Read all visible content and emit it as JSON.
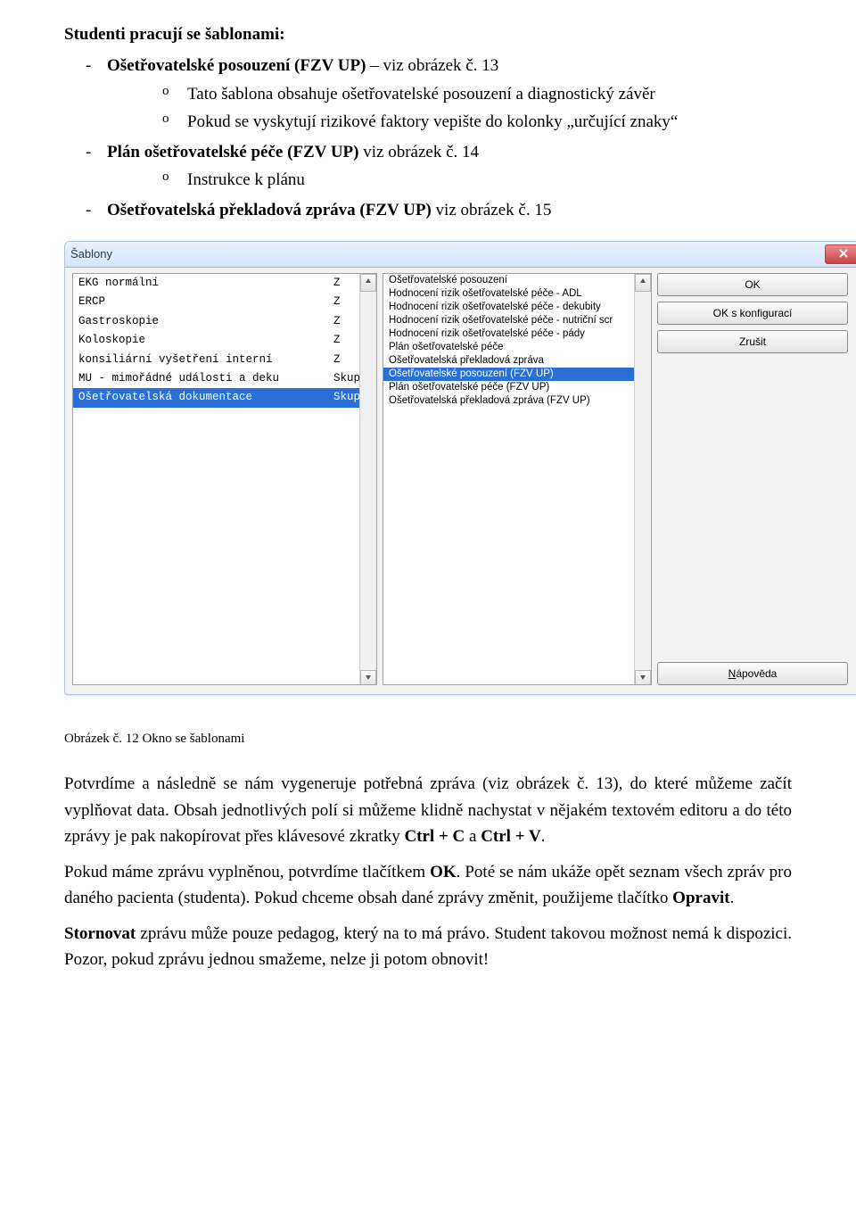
{
  "doc": {
    "heading": "Studenti pracují se šablonami:",
    "dash1_prefix": "Ošetřovatelské posouzení (FZV UP)",
    "dash1_rest": " – viz obrázek č. 13",
    "circ1a": "Tato šablona obsahuje ošetřovatelské posouzení a diagnostický závěr",
    "circ1b": "Pokud se vyskytují rizikové faktory vepište do kolonky „určující znaky“",
    "dash2_prefix": "Plán ošetřovatelské péče (FZV UP)",
    "dash2_rest": " viz obrázek č. 14",
    "circ2a": "Instrukce k plánu",
    "dash3_prefix": "Ošetřovatelská překladová zpráva (FZV UP)",
    "dash3_rest": " viz obrázek č. 15"
  },
  "dialog": {
    "title": "Šablony",
    "buttons": {
      "ok": "OK",
      "ok_cfg": "OK s konfigurací",
      "cancel": "Zrušit",
      "help": "Nápověda"
    },
    "left": [
      {
        "name": "EKG normální",
        "type": "Z",
        "sel": false
      },
      {
        "name": "ERCP",
        "type": "Z",
        "sel": false
      },
      {
        "name": "Gastroskopie",
        "type": "Z",
        "sel": false
      },
      {
        "name": "Koloskopie",
        "type": "Z",
        "sel": false
      },
      {
        "name": "konsiliární vyšetření interní",
        "type": "Z",
        "sel": false
      },
      {
        "name": "MU - mimořádné události a deku",
        "type": "Skup",
        "sel": false
      },
      {
        "name": "Ošetřovatelská dokumentace",
        "type": "Skup",
        "sel": true
      }
    ],
    "mid": [
      {
        "label": "Ošetřovatelské posouzení",
        "sel": false
      },
      {
        "label": "Hodnocení rizik ošetřovatelské péče - ADL",
        "sel": false
      },
      {
        "label": "Hodnocení rizik ošetřovatelské péče - dekubity",
        "sel": false
      },
      {
        "label": "Hodnocení rizik ošetřovatelské péče - nutriční scr",
        "sel": false
      },
      {
        "label": "Hodnocení rizik ošetřovatelské péče - pády",
        "sel": false
      },
      {
        "label": "Plán ošetřovatelské péče",
        "sel": false
      },
      {
        "label": "Ošetřovatelská překladová zpráva",
        "sel": false
      },
      {
        "label": "Ošetřovatelské posouzení (FZV UP)",
        "sel": true
      },
      {
        "label": "Plán ošetřovatelské péče (FZV UP)",
        "sel": false
      },
      {
        "label": "Ošetřovatelská překladová zpráva (FZV UP)",
        "sel": false
      }
    ]
  },
  "caption": "Obrázek č. 12 Okno se šablonami",
  "para1_a": "Potvrdíme a následně se nám vygeneruje potřebná zpráva (viz obrázek č. 13), do které můžeme začít vyplňovat data. Obsah jednotlivých polí si můžeme klidně nachystat v nějakém textovém editoru a do této zprávy je pak nakopírovat přes klávesové zkratky ",
  "para1_b1": "Ctrl + C",
  "para1_mid": " a ",
  "para1_b2": "Ctrl + V",
  "para1_end": ".",
  "para2_a": "Pokud máme zprávu vyplněnou, potvrdíme tlačítkem ",
  "para2_b": "OK",
  "para2_c": ". Poté se nám ukáže opět seznam všech zpráv pro daného pacienta (studenta). Pokud chceme obsah dané zprávy změnit, použijeme tlačítko ",
  "para2_d": "Opravit",
  "para2_e": ".",
  "para3_a": "Stornovat",
  "para3_b": " zprávu může pouze pedagog, který na to má právo. Student takovou možnost nemá k dispozici. Pozor, pokud zprávu jednou smažeme, nelze ji potom obnovit!"
}
